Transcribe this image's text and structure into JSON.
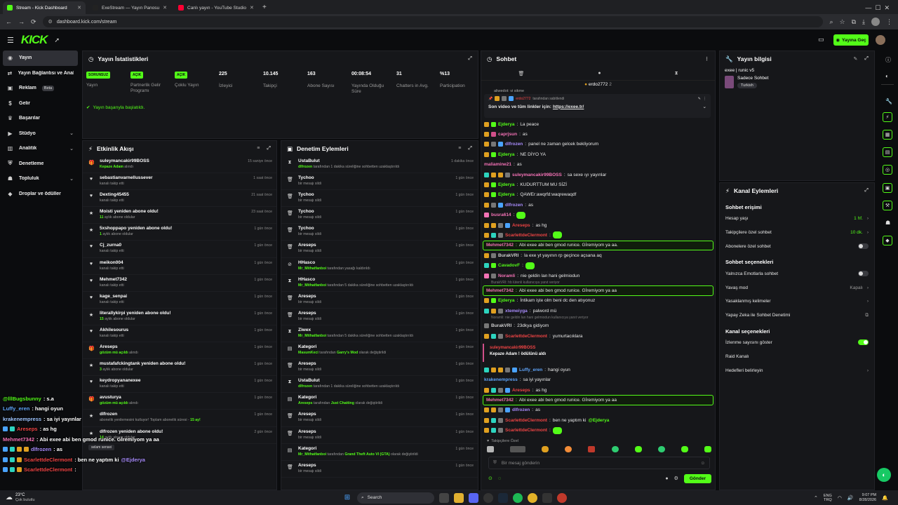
{
  "browser": {
    "tabs": [
      {
        "title": "Stream - Kick Dashboard",
        "color": "#53fc18",
        "active": true
      },
      {
        "title": "ExeStream — Yayın Panosu",
        "color": "#222222",
        "active": false
      },
      {
        "title": "Canlı yayın - YouTube Studio",
        "color": "#ff0033",
        "active": false
      }
    ],
    "url": "dashboard.kick.com/stream",
    "new_tab": "+"
  },
  "header": {
    "logo": "KICK",
    "go_live": "Yayına Geç"
  },
  "sidebar": {
    "items": [
      {
        "label": "Yayın",
        "icon": "broadcast-icon",
        "active": true
      },
      {
        "label": "Yayın Bağlantısı ve Anahtarı",
        "icon": "link-icon"
      },
      {
        "label": "Reklam",
        "icon": "ad-icon",
        "badge": "Beta"
      },
      {
        "label": "Gelir",
        "icon": "money-icon"
      },
      {
        "label": "Başarılar",
        "icon": "trophy-icon"
      },
      {
        "label": "Stüdyo",
        "icon": "studio-icon",
        "chev": true
      },
      {
        "label": "Analitik",
        "icon": "chart-icon",
        "chev": true
      },
      {
        "label": "Denetleme",
        "icon": "shield-icon"
      },
      {
        "label": "Topluluk",
        "icon": "community-icon",
        "chev": true
      },
      {
        "label": "Droplar ve ödüller",
        "icon": "gift-icon"
      }
    ]
  },
  "stats": {
    "title": "Yayın İstatistikleri",
    "items": [
      {
        "value": "SORUNSUZ",
        "label": "Yayın",
        "badge": true
      },
      {
        "value": "AÇIK",
        "label": "Partnerlik Gelir Programı",
        "badge": true
      },
      {
        "value": "AÇIK",
        "label": "Çoklu Yayın",
        "badge": true
      },
      {
        "value": "225",
        "label": "İzleyici"
      },
      {
        "value": "10.145",
        "label": "Takipçi"
      },
      {
        "value": "163",
        "label": "Abone Sayısı"
      },
      {
        "value": "00:08:54",
        "label": "Yayında Olduğu Süre"
      },
      {
        "value": "31",
        "label": "Chatters in Avg."
      },
      {
        "value": "%13",
        "label": "Participation"
      }
    ],
    "status": "Yayın başarıyla başlatıldı."
  },
  "activity": {
    "title": "Etkinlik Akışı",
    "items": [
      {
        "icon": "gift-icon",
        "name": "suleymancakir99BOSS",
        "sub_name": "Kepaze Adam",
        "sub": " alındı",
        "time": "15 saniye önce"
      },
      {
        "icon": "heart-icon",
        "name": "sebastianvarnellussever",
        "sub": "kanalı takip etti",
        "time": "1 saat önce"
      },
      {
        "icon": "heart-icon",
        "name": "Dexting45455",
        "sub": "kanalı takip etti",
        "time": "21 saat önce"
      },
      {
        "icon": "star-icon",
        "name": "Moisti yeniden abone oldu!",
        "sub_name": "11",
        "sub": " aylık abone oldular",
        "time": "23 saat önce"
      },
      {
        "icon": "star-icon",
        "name": "5xshoppapo yeniden abone oldu!",
        "sub_name": "1",
        "sub": " aylık abone oldular",
        "time": "1 gün önce"
      },
      {
        "icon": "heart-icon",
        "name": "Cj_zurna0",
        "sub": "kanalı takip etti",
        "time": "1 gün önce"
      },
      {
        "icon": "heart-icon",
        "name": "meikon004",
        "sub": "kanalı takip etti",
        "time": "1 gün önce"
      },
      {
        "icon": "heart-icon",
        "name": "Mehmet7342",
        "sub": "kanalı takip etti",
        "time": "1 gün önce"
      },
      {
        "icon": "heart-icon",
        "name": "kage_senpai",
        "sub": "kanalı takip etti",
        "time": "1 gün önce"
      },
      {
        "icon": "star-icon",
        "name": "literallykirpi yeniden abone oldu!",
        "sub_name": "15",
        "sub": " aylık abone oldular",
        "time": "1 gün önce"
      },
      {
        "icon": "heart-icon",
        "name": "Akhilesourus",
        "sub": "kanalı takip etti",
        "time": "1 gün önce"
      },
      {
        "icon": "gift-icon",
        "name": "Areseps",
        "sub_name": "gözüm mü açıldı",
        "sub": " alındı",
        "time": "1 gün önce"
      },
      {
        "icon": "star-icon",
        "name": "mustafafckingtank yeniden abone oldu!",
        "sub_name": "3",
        "sub": " aylık abone oldular",
        "time": "1 gün önce"
      },
      {
        "icon": "heart-icon",
        "name": "keydropyananexee",
        "sub": "kanalı takip etti",
        "time": "1 gün önce"
      },
      {
        "icon": "gift-icon",
        "name": "avusturya",
        "sub_name": "gözüm mü açıldı",
        "sub": " alındı",
        "time": "1 gün önce"
      },
      {
        "icon": "star-icon",
        "name": "dlfrozen",
        "sub": "abonelik yenilemesini kutluyor! Toplam abonelik süresi - ",
        "sub_tail": "15 ay!",
        "time": "1 gün önce"
      },
      {
        "icon": "star-icon",
        "name": "dlfrozen yeniden abone oldu!",
        "sub_name": "14",
        "sub": " aylık abone oldular",
        "time": "2 gün önce"
      }
    ],
    "note": "selam sensei"
  },
  "moderation": {
    "title": "Denetim Eylemleri",
    "items": [
      {
        "icon": "timeout-icon",
        "name": "UstaBulut",
        "sub_name": "dlfrozen",
        "sub": " tarafından 1 dakika süreliğine sohbetten uzaklaştırıldı",
        "time": "1 dakika önce"
      },
      {
        "icon": "trash-icon",
        "name": "Tychoo",
        "sub": "bir mesajı sildi",
        "time": "1 gün önce"
      },
      {
        "icon": "trash-icon",
        "name": "Tychoo",
        "sub": "bir mesajı sildi",
        "time": "1 gün önce"
      },
      {
        "icon": "trash-icon",
        "name": "Tychoo",
        "sub": "bir mesajı sildi",
        "time": "1 gün önce"
      },
      {
        "icon": "trash-icon",
        "name": "Tychoo",
        "sub": "bir mesajı sildi",
        "time": "1 gün önce"
      },
      {
        "icon": "trash-icon",
        "name": "Areseps",
        "sub": "bir mesajı sildi",
        "time": "1 gün önce"
      },
      {
        "icon": "ban-icon",
        "name": "HHasco",
        "sub_name": "Mr_Mithatfanboi",
        "sub": " tarafından yasağı kaldırıldı",
        "time": "1 gün önce"
      },
      {
        "icon": "timeout-icon",
        "name": "HHasco",
        "sub_name": "Mr_Mithatfanboi",
        "sub": " tarafından 5 dakika süreliğine sohbetten uzaklaştırıldı",
        "time": "1 gün önce"
      },
      {
        "icon": "trash-icon",
        "name": "Areseps",
        "sub": "bir mesajı sildi",
        "time": "1 gün önce"
      },
      {
        "icon": "trash-icon",
        "name": "Areseps",
        "sub": "bir mesajı sildi",
        "time": "1 gün önce"
      },
      {
        "icon": "timeout-icon",
        "name": "Ziwex",
        "sub_name": "Mr_Mithatfanboi",
        "sub": " tarafından 5 dakika süreliğine sohbetten uzaklaştırıldı",
        "time": "1 gün önce"
      },
      {
        "icon": "category-icon",
        "name": "Kategori",
        "sub_name": "MasumKeci",
        "sub": " tarafından ",
        "sub_mid": "Garry's Mod",
        "sub_tail": " olarak değiştirildi",
        "time": "1 gün önce"
      },
      {
        "icon": "trash-icon",
        "name": "Areseps",
        "sub": "bir mesajı sildi",
        "time": "1 gün önce"
      },
      {
        "icon": "timeout-icon",
        "name": "UstaBulut",
        "sub_name": "dlfrozen",
        "sub": " tarafından 1 dakika süreliğine sohbetten uzaklaştırıldı",
        "time": "1 gün önce"
      },
      {
        "icon": "category-icon",
        "name": "Kategori",
        "sub_name": "Areseps",
        "sub": " tarafından ",
        "sub_mid": "Just Chatting",
        "sub_tail": " olarak değiştirildi",
        "time": "1 gün önce"
      },
      {
        "icon": "trash-icon",
        "name": "Areseps",
        "sub": "bir mesajı sildi",
        "time": "1 gün önce"
      },
      {
        "icon": "trash-icon",
        "name": "Areseps",
        "sub": "bir mesajı sildi",
        "time": "1 gün önce"
      },
      {
        "icon": "category-icon",
        "name": "Kategori",
        "sub_name": "Mr_Mithatfanboi",
        "sub": " tarafından ",
        "sub_mid": "Grand Theft Auto VI (GTA)",
        "sub_tail": " olarak değiştirildi",
        "time": "1 gün önce"
      },
      {
        "icon": "trash-icon",
        "name": "Areseps",
        "sub": "bir mesajı sildi",
        "time": "1 gün önce"
      }
    ]
  },
  "chat": {
    "title": "Sohbet",
    "pinned_user": "erdo2772",
    "pinned_count": "2",
    "pinned_by": "tarafından sabitlendi",
    "pinned_prefix": "Son video ve tüm linkler için: ",
    "pinned_link": "https://exee.tr/",
    "top_cut": "aliwedot: vi sikme",
    "messages": [
      {
        "user": "Ejderya",
        "color": "#53fc18",
        "text": "La peace",
        "hl": false,
        "badges": [
          "#e0a020",
          "#53fc18"
        ]
      },
      {
        "user": "caprjsun",
        "color": "#f472b6",
        "text": "as",
        "badges": [
          "#e0a020",
          "#d14f8a"
        ]
      },
      {
        "user": "dlfrozen",
        "color": "#a78bfa",
        "text": "panel ne zaman gelcek bekliyorum",
        "badges": [
          "#e0a020",
          "#777777",
          "#4aa3ff"
        ]
      },
      {
        "user": "Ejderya",
        "color": "#53fc18",
        "text": "NE DİYO YA",
        "badges": [
          "#e0a020",
          "#53fc18"
        ]
      },
      {
        "user": "maliamine21",
        "color": "#f472b6",
        "text": "as",
        "badges": []
      },
      {
        "user": "suleymancakir99BOSS",
        "color": "#f472b6",
        "text": "sa sexe ıyı yayınlar",
        "badges": [
          "#2dd4bf",
          "#e0a020",
          "#e0a020",
          "#777777"
        ]
      },
      {
        "user": "Ejderya",
        "color": "#53fc18",
        "text": "KUDURTTUM MU SİZİ",
        "badges": [
          "#e0a020",
          "#53fc18"
        ]
      },
      {
        "user": "Ejderya",
        "color": "#53fc18",
        "text": "QAWEr:awqrfd:waqrewaqdf",
        "badges": [
          "#e0a020",
          "#53fc18"
        ]
      },
      {
        "user": "dlfrozen",
        "color": "#a78bfa",
        "text": "as",
        "badges": [
          "#e0a020",
          "#777777",
          "#4aa3ff"
        ]
      },
      {
        "user": "busra614",
        "color": "#f472b6",
        "text": "",
        "badges": [
          "#f472b6"
        ]
      },
      {
        "user": "Areseps",
        "color": "#ef4444",
        "text": "as hg",
        "badges": [
          "#e0a020",
          "#e0a020",
          "#777777",
          "#4aa3ff"
        ]
      },
      {
        "user": "ScarlettdeClermont",
        "color": "#ef4444",
        "text": "",
        "badges": [
          "#e0a020",
          "#2dd4bf",
          "#777777"
        ]
      },
      {
        "user": "Mehmet7342",
        "color": "#f472b6",
        "text": "Abi exee abi ben gmod runice. Gİremiyom ya aa.",
        "hl": true,
        "badges": []
      },
      {
        "user": "BurakVRI",
        "color": "#cfcfcf",
        "text": "la exe yt yayının rp geçince açsana aq",
        "badges": [
          "#e0a020",
          "#777777"
        ]
      },
      {
        "user": "CavadovF",
        "color": "#53fc18",
        "text": "",
        "badges": [
          "#2dd4bf",
          "#53fc18"
        ]
      },
      {
        "user": "Noramli",
        "color": "#f472b6",
        "text": "nie geldin lan hani gelmiodun",
        "badges": [
          "#f472b6",
          "#777777"
        ]
      },
      {
        "user": "Mehmet7342",
        "color": "#f472b6",
        "text": "Abi exee abi ben gmod runice. Gİremiyom ya aa",
        "hl": true,
        "badges": []
      },
      {
        "user": "Ejderya",
        "color": "#53fc18",
        "text": "İntikam işte olm beni dc den atıyonuz",
        "badges": [
          "#e0a020",
          "#53fc18"
        ]
      },
      {
        "user": "xtemeiyga",
        "color": "#a78bfa",
        "text": "palword mü",
        "badges": [
          "#2dd4bf",
          "#e0a020",
          "#777777"
        ]
      },
      {
        "user": "BurakVRI",
        "color": "#cfcfcf",
        "text": "23dkya gidiyom",
        "badges": [
          "#777777"
        ]
      },
      {
        "user": "ScarlettdeClermont",
        "color": "#ef4444",
        "text": "yumurtacıklara",
        "badges": [
          "#e0a020",
          "#2dd4bf",
          "#777777"
        ]
      }
    ],
    "sys1": "BurakVRI: hb lütenli kullanıcıya yanıt veriyor",
    "sys2": "Noramli: nie geldin lan hani gelmiodun kullanıcıya yanıt veriyor",
    "redeem": {
      "user": "suleymancakir99BOSS",
      "text": "Kepaze Adam ! ödülünü aldı"
    },
    "messages2": [
      {
        "user": "Luffy_eren",
        "color": "#60a5fa",
        "text": "hangi oyun",
        "badges": [
          "#2dd4bf",
          "#e0a020",
          "#e0a020",
          "#777777",
          "#4aa3ff"
        ]
      },
      {
        "user": "krakenempress",
        "color": "#60a5fa",
        "text": "sa iyi yayınlar",
        "badges": []
      },
      {
        "user": "Areseps",
        "color": "#ef4444",
        "text": "as hg",
        "badges": [
          "#e0a020",
          "#2dd4bf",
          "#777777",
          "#4aa3ff"
        ]
      },
      {
        "user": "Mehmet7342",
        "color": "#f472b6",
        "text": "Abi exee abi ben gmod runice. Gİremiyom ya aa",
        "hl": true,
        "badges": []
      },
      {
        "user": "dlfrozen",
        "color": "#a78bfa",
        "text": "as",
        "badges": [
          "#e0a020",
          "#e0a020",
          "#777777",
          "#4aa3ff"
        ]
      },
      {
        "user": "ScarlettdeClermont",
        "color": "#ef4444",
        "text": "ben ne yaptım ki ",
        "mention": "@Ejderya",
        "badges": [
          "#e0a020",
          "#2dd4bf",
          "#777777"
        ]
      },
      {
        "user": "ScarlettdeClermont",
        "color": "#ef4444",
        "text": "",
        "badges": [
          "#e0a020",
          "#2dd4bf",
          "#777777"
        ]
      }
    ],
    "followers_only": "Takipçilere Özel",
    "input_placeholder": "Bir mesaj gönderin",
    "send": "Gönder"
  },
  "info": {
    "title": "Yayın bilgisi",
    "stream_title": "exee | runic v5",
    "category": "Sadece Sohbet",
    "tag": "Turkish"
  },
  "channel_actions": {
    "title": "Kanal Eylemleri",
    "chat_access": "Sohbet erişimi",
    "rows1": [
      {
        "label": "Hesap yaşı",
        "value": "1 hf.",
        "green": true,
        "chev": true
      },
      {
        "label": "Takipçilere özel sohbet",
        "value": "10 dk.",
        "green": true,
        "chev": true
      },
      {
        "label": "Abonelere özel sohbet",
        "toggle": false
      }
    ],
    "chat_options": "Sohbet seçenekleri",
    "rows2": [
      {
        "label": "Yalnızca Emotlarla sohbet",
        "toggle": false
      },
      {
        "label": "Yavaş mod",
        "value": "Kapalı",
        "chev": true
      },
      {
        "label": "Yasaklanmış kelimeler",
        "chev": true
      },
      {
        "label": "Yapay Zeka ile Sohbet Denetimi",
        "ext": true
      }
    ],
    "channel_options": "Kanal seçenekleri",
    "rows3": [
      {
        "label": "İzlenme sayısını göster",
        "toggle": true
      },
      {
        "label": "Raid Kanalı"
      },
      {
        "label": "Hedefleri belirleyin",
        "chev": true
      }
    ]
  },
  "overlay": [
    {
      "user": "@lllBugsbunny",
      "color": "#53fc18",
      "text": ": s.a",
      "badges": []
    },
    {
      "user": "Luffy_eren",
      "color": "#60a5fa",
      "text": ": hangi oyun",
      "badges": []
    },
    {
      "user": "krakenempress",
      "color": "#9ec5ff",
      "text": ": sa iyi yayınlar",
      "badges": []
    },
    {
      "user": "Areseps",
      "color": "#ef4444",
      "text": ": as hg",
      "badges": [
        "#4aa3ff",
        "#2dd4bf"
      ]
    },
    {
      "user": "Mehmet7342",
      "color": "#f472b6",
      "text": ": Abi exee abi ben gmod runice. Gİremiyom ya aa",
      "badges": []
    },
    {
      "user": "dlfrozen",
      "color": "#a78bfa",
      "text": ": as",
      "badges": [
        "#4aa3ff",
        "#2dd4bf",
        "#e0a020",
        "#e0a020"
      ]
    },
    {
      "user": "ScarlettdeClermont",
      "color": "#ef4444",
      "text": ": ben ne yaptım ki ",
      "mention": "@Ejderya",
      "badges": [
        "#4aa3ff",
        "#2dd4bf",
        "#e0a020"
      ]
    },
    {
      "user": "ScarlettdeClermont",
      "color": "#ef4444",
      "text": ":",
      "badges": [
        "#4aa3ff",
        "#2dd4bf",
        "#e0a020"
      ]
    }
  ],
  "taskbar": {
    "temp": "23°C",
    "weather": "Çok bulutlu",
    "search": "Search",
    "lang1": "ENG",
    "lang2": "TRQ",
    "time": "9:07 PM",
    "date": "8/28/2026"
  }
}
